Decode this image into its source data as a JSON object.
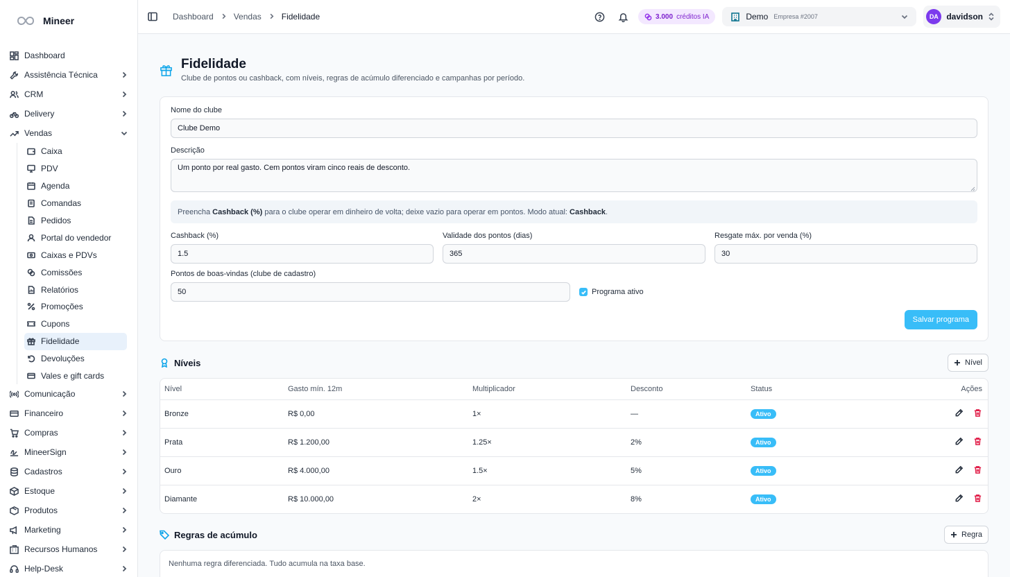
{
  "brand": {
    "name": "Mineer"
  },
  "sidebar": {
    "items": [
      {
        "label": "Dashboard",
        "icon": "dashboard-icon",
        "chevron": false
      },
      {
        "label": "Assistência Técnica",
        "icon": "wrench-icon",
        "chevron": true
      },
      {
        "label": "CRM",
        "icon": "users-icon",
        "chevron": true
      },
      {
        "label": "Delivery",
        "icon": "bike-icon",
        "chevron": true
      },
      {
        "label": "Vendas",
        "icon": "trend-icon",
        "chevron": true,
        "expanded": true
      }
    ],
    "vendas_sub": [
      {
        "label": "Caixa",
        "icon": "wallet-icon"
      },
      {
        "label": "PDV",
        "icon": "monitor-icon"
      },
      {
        "label": "Agenda",
        "icon": "calendar-icon"
      },
      {
        "label": "Comandas",
        "icon": "clipboard-icon"
      },
      {
        "label": "Pedidos",
        "icon": "document-icon"
      },
      {
        "label": "Portal do vendedor",
        "icon": "user-icon"
      },
      {
        "label": "Caixas e PDVs",
        "icon": "register-icon"
      },
      {
        "label": "Comissões",
        "icon": "coins-icon"
      },
      {
        "label": "Relatórios",
        "icon": "report-icon"
      },
      {
        "label": "Promoções",
        "icon": "percent-icon"
      },
      {
        "label": "Cupons",
        "icon": "ticket-icon"
      },
      {
        "label": "Fidelidade",
        "icon": "gift-icon",
        "active": true
      },
      {
        "label": "Devoluções",
        "icon": "undo-icon"
      },
      {
        "label": "Vales e gift cards",
        "icon": "card-icon"
      }
    ],
    "items_after": [
      {
        "label": "Comunicação",
        "icon": "radio-icon"
      },
      {
        "label": "Financeiro",
        "icon": "credit-card-icon"
      },
      {
        "label": "Compras",
        "icon": "cart-icon"
      },
      {
        "label": "MineerSign",
        "icon": "signature-icon"
      },
      {
        "label": "Cadastros",
        "icon": "database-icon"
      },
      {
        "label": "Estoque",
        "icon": "box-icon"
      },
      {
        "label": "Produtos",
        "icon": "package-icon"
      },
      {
        "label": "Marketing",
        "icon": "megaphone-icon"
      },
      {
        "label": "Recursos Humanos",
        "icon": "building-icon"
      },
      {
        "label": "Help-Desk",
        "icon": "headset-icon"
      }
    ]
  },
  "topbar": {
    "breadcrumb": [
      "Dashboard",
      "Vendas",
      "Fidelidade"
    ],
    "credits_value": "3.000",
    "credits_label": "créditos IA",
    "company_name": "Demo",
    "company_sub": "Empresa #2007",
    "user_initials": "DA",
    "user_name": "davidson"
  },
  "page": {
    "title": "Fidelidade",
    "subtitle": "Clube de pontos ou cashback, com níveis, regras de acúmulo diferenciado e campanhas por período."
  },
  "form": {
    "nome_label": "Nome do clube",
    "nome_value": "Clube Demo",
    "descricao_label": "Descrição",
    "descricao_value": "Um ponto por real gasto. Cem pontos viram cinco reais de desconto.",
    "info_prefix": "Preencha ",
    "info_bold1": "Cashback (%)",
    "info_middle": " para o clube operar em dinheiro de volta; deixe vazio para operar em pontos. Modo atual: ",
    "info_bold2": "Cashback",
    "info_suffix": ".",
    "cashback_label": "Cashback (%)",
    "cashback_value": "1.5",
    "validade_label": "Validade dos pontos (dias)",
    "validade_value": "365",
    "resgate_label": "Resgate máx. por venda (%)",
    "resgate_value": "30",
    "boasvindas_label": "Pontos de boas-vindas (clube de cadastro)",
    "boasvindas_value": "50",
    "ativo_label": "Programa ativo",
    "ativo_checked": true,
    "save_label": "Salvar programa"
  },
  "niveis": {
    "title": "Níveis",
    "add_label": "Nível",
    "columns": [
      "Nível",
      "Gasto mín. 12m",
      "Multiplicador",
      "Desconto",
      "Status",
      "Ações"
    ],
    "rows": [
      {
        "nivel": "Bronze",
        "gasto": "R$ 0,00",
        "mult": "1×",
        "desconto": "—",
        "status": "Ativo"
      },
      {
        "nivel": "Prata",
        "gasto": "R$ 1.200,00",
        "mult": "1.25×",
        "desconto": "2%",
        "status": "Ativo"
      },
      {
        "nivel": "Ouro",
        "gasto": "R$ 4.000,00",
        "mult": "1.5×",
        "desconto": "5%",
        "status": "Ativo"
      },
      {
        "nivel": "Diamante",
        "gasto": "R$ 10.000,00",
        "mult": "2×",
        "desconto": "8%",
        "status": "Ativo"
      }
    ]
  },
  "regras": {
    "title": "Regras de acúmulo",
    "add_label": "Regra",
    "empty": "Nenhuma regra diferenciada. Tudo acumula na taxa base."
  },
  "colors": {
    "accent": "#38bdf8",
    "active_bg": "#e8f1fb",
    "danger": "#e11d48",
    "credits": "#7e22ce"
  }
}
